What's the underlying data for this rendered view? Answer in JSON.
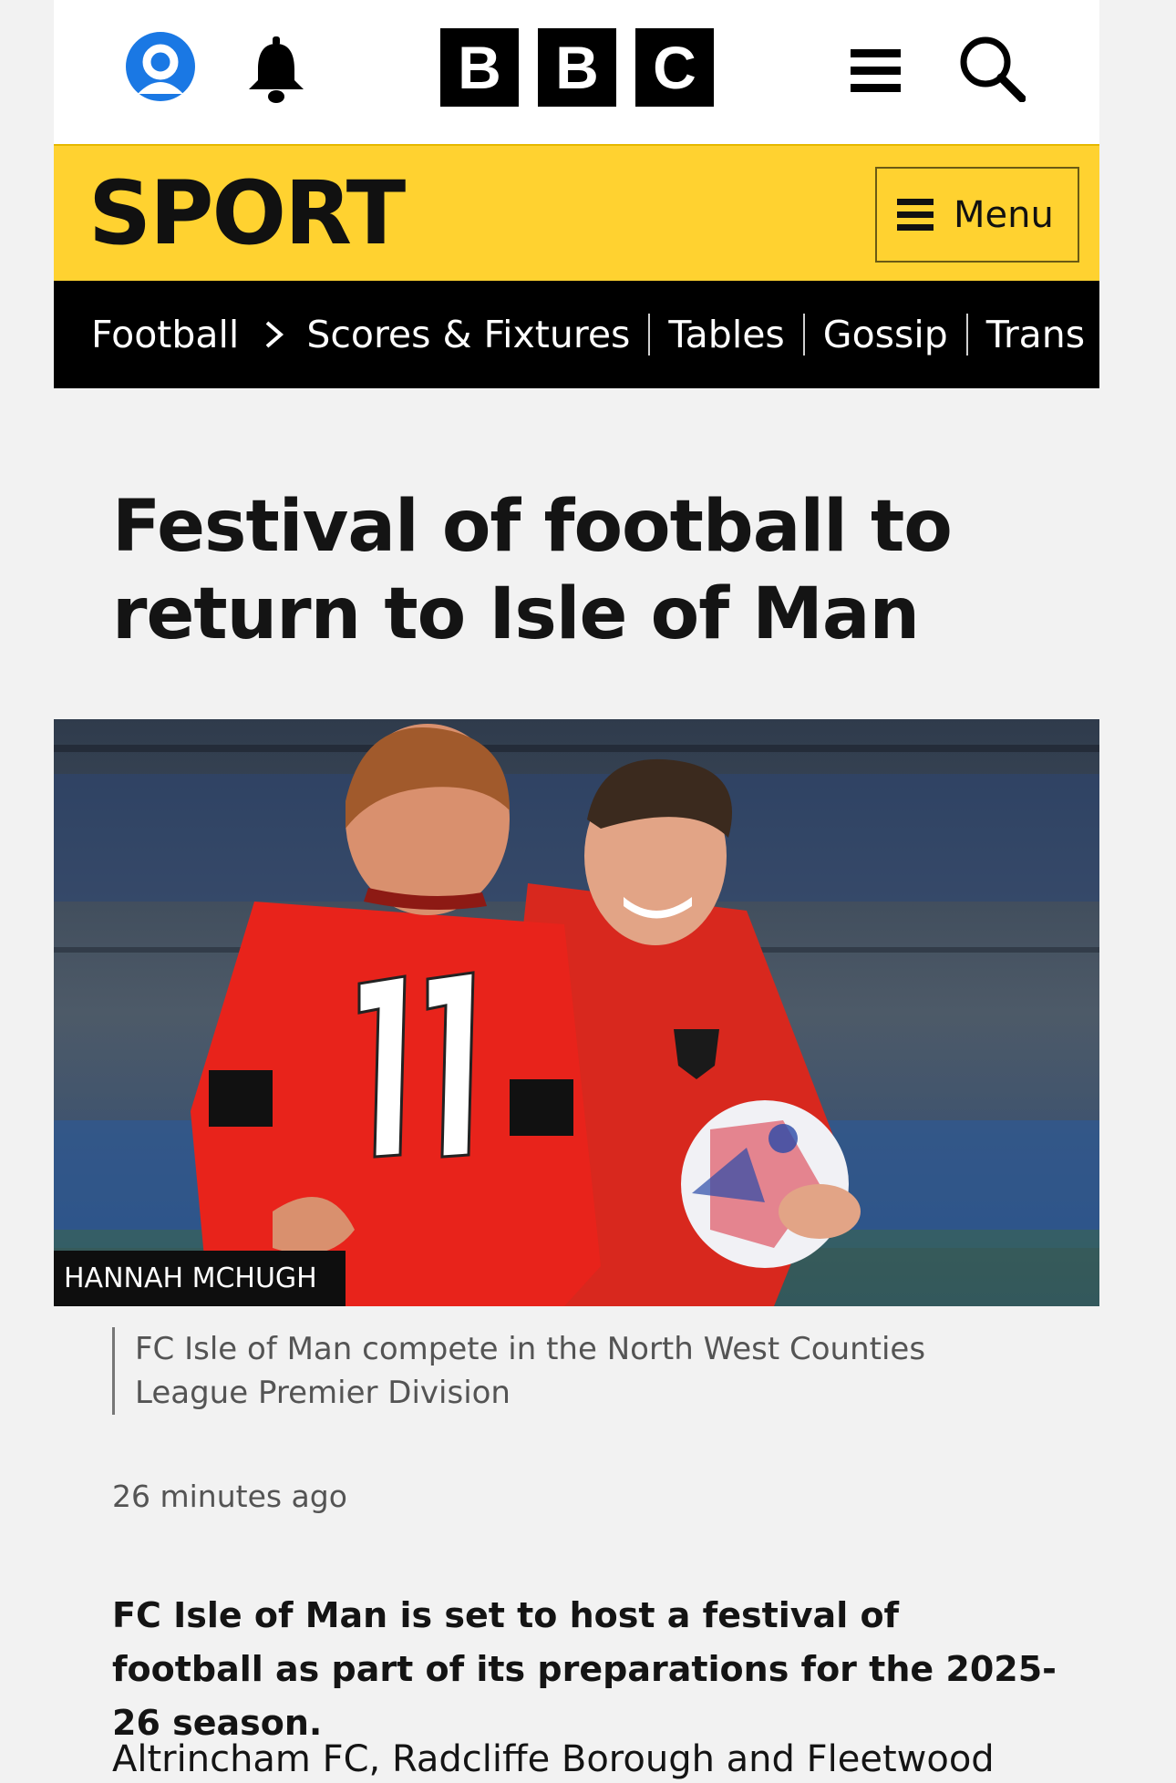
{
  "header": {
    "logo": [
      "B",
      "B",
      "C"
    ],
    "icons": {
      "account": "account-icon",
      "notifications": "bell-icon",
      "menu": "hamburger-icon",
      "search": "search-icon"
    }
  },
  "sport_banner": {
    "title": "SPORT",
    "menu_label": "Menu",
    "color": "#ffd230"
  },
  "nav": {
    "items": [
      "Football",
      "Scores & Fixtures",
      "Tables",
      "Gossip",
      "Trans"
    ]
  },
  "article": {
    "headline": "Festival of football to return to Isle of Man",
    "image_credit": "HANNAH MCHUGH",
    "image_caption": "FC Isle of Man compete in the North West Counties League Premier Division",
    "timestamp": "26 minutes ago",
    "lead": "FC Isle of Man is set to host a festival of football as part of its preparations for the 2025-26 season.",
    "body_first_line": "Altrincham FC, Radcliffe Borough and Fleetwood"
  }
}
